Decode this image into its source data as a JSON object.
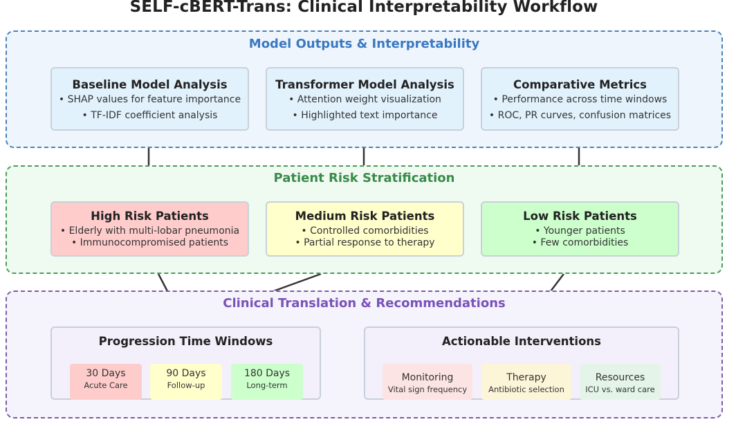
{
  "title": "SELF-cBERT-Trans: Clinical Interpretability Workflow",
  "sections": {
    "outputs": {
      "title": "Model Outputs & Interpretability",
      "cards": [
        {
          "title": "Baseline Model Analysis",
          "lines": [
            "• SHAP values for feature importance",
            "• TF-IDF coefficient analysis"
          ]
        },
        {
          "title": "Transformer Model Analysis",
          "lines": [
            "• Attention weight visualization",
            "• Highlighted text importance"
          ]
        },
        {
          "title": "Comparative Metrics",
          "lines": [
            "• Performance across time windows",
            "• ROC, PR curves, confusion matrices"
          ]
        }
      ]
    },
    "risk": {
      "title": "Patient Risk Stratification",
      "cards": [
        {
          "title": "High Risk Patients",
          "lines": [
            "• Elderly with multi-lobar pneumonia",
            "• Immunocompromised patients"
          ]
        },
        {
          "title": "Medium Risk Patients",
          "lines": [
            "• Controlled comorbidities",
            "• Partial response to therapy"
          ]
        },
        {
          "title": "Low Risk Patients",
          "lines": [
            "• Younger patients",
            "• Few comorbidities"
          ]
        }
      ]
    },
    "clinical": {
      "title": "Clinical Translation & Recommendations",
      "time_windows": {
        "title": "Progression Time Windows",
        "chips": [
          {
            "main": "30 Days",
            "sub": "Acute Care"
          },
          {
            "main": "90 Days",
            "sub": "Follow-up"
          },
          {
            "main": "180 Days",
            "sub": "Long-term"
          }
        ]
      },
      "interventions": {
        "title": "Actionable Interventions",
        "chips": [
          {
            "main": "Monitoring",
            "sub": "Vital sign frequency"
          },
          {
            "main": "Therapy",
            "sub": "Antibiotic selection"
          },
          {
            "main": "Resources",
            "sub": "ICU vs. ward care"
          }
        ]
      }
    }
  },
  "colors": {
    "blue_border": "#4a7fb5",
    "blue_title": "#3a78c0",
    "green_border": "#4a9a5a",
    "green_title": "#3a8a4a",
    "purple_border": "#7b5aa6",
    "purple_title": "#7a52b8",
    "high_risk": "#ffcccc",
    "medium_risk": "#ffffcc",
    "low_risk": "#ccffcc"
  }
}
